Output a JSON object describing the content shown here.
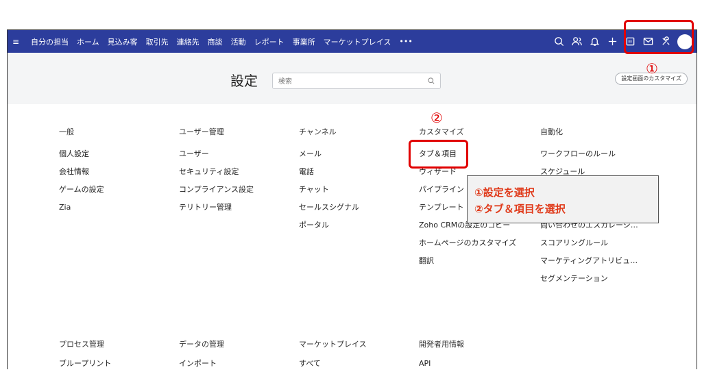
{
  "nav": {
    "menu_icon": "≡",
    "items": [
      "自分の担当",
      "ホーム",
      "見込み客",
      "取引先",
      "連絡先",
      "商談",
      "活動",
      "レポート",
      "事業所",
      "マーケットプレイス",
      "•••"
    ],
    "icons": [
      "search-icon",
      "users-icon",
      "bell-icon",
      "plus-icon",
      "calendar-icon",
      "mail-icon",
      "tools-icon"
    ],
    "background": "#2c3d9c"
  },
  "header": {
    "title": "設定",
    "search_placeholder": "検索",
    "customize_label": "設定画面のカスタマイズ"
  },
  "columns": [
    {
      "heading": "一般",
      "links": [
        "個人設定",
        "会社情報",
        "ゲームの設定",
        "Zia"
      ]
    },
    {
      "heading": "ユーザー管理",
      "links": [
        "ユーザー",
        "セキュリティ設定",
        "コンプライアンス設定",
        "テリトリー管理"
      ]
    },
    {
      "heading": "チャンネル",
      "links": [
        "メール",
        "電話",
        "チャット",
        "セールスシグナル",
        "ポータル"
      ]
    },
    {
      "heading": "カスタマイズ",
      "links": [
        "タブ＆項目",
        "ウィザード",
        "パイプライン",
        "テンプレート",
        "Zoho CRMの設定のコピー",
        "ホームページのカスタマイズ",
        "翻訳"
      ]
    },
    {
      "heading": "自動化",
      "links": [
        "ワークフローのルール",
        "スケジュール",
        "",
        "",
        "問い合わせのエスカレーシ…",
        "スコアリングルール",
        "マーケティングアトリビュ…",
        "セグメンテーション"
      ]
    }
  ],
  "bottom_sections": [
    {
      "heading": "プロセス管理",
      "first_link": "ブループリント"
    },
    {
      "heading": "データの管理",
      "first_link": "インポート"
    },
    {
      "heading": "マーケットプレイス",
      "first_link": "すべて"
    },
    {
      "heading": "開発者用情報",
      "first_link": "API"
    }
  ],
  "annotations": {
    "marker_1": "①",
    "marker_2": "②",
    "callout_line1": "①設定を選択",
    "callout_line2": "②タブ＆項目を選択",
    "highlight_color": "#e10000",
    "callout_text_color": "#e03a1a"
  }
}
